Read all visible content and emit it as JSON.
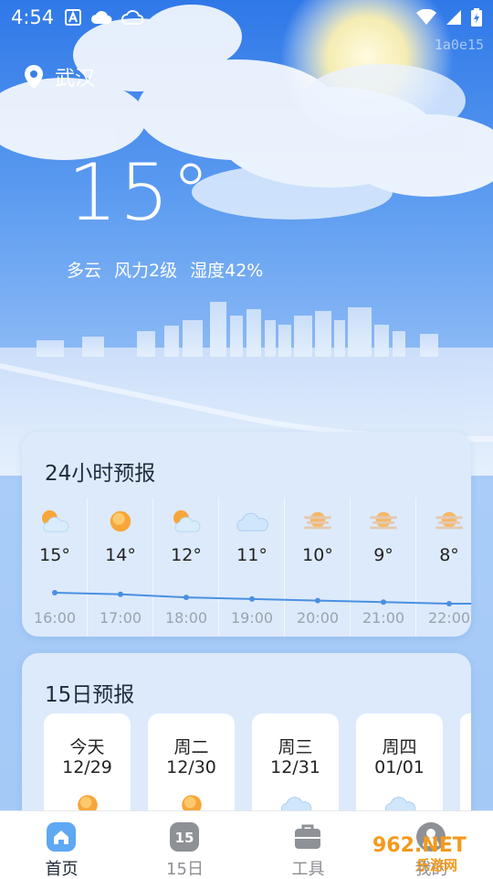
{
  "status": {
    "time": "4:54",
    "left_icons": [
      "a-badge-icon",
      "cloud-filled-icon",
      "cloud-outline-icon"
    ],
    "right_icons": [
      "wifi-icon",
      "signal-icon",
      "battery-icon"
    ]
  },
  "build_tag": "1a0e15",
  "location": {
    "city": "武汉",
    "icon": "location-pin-icon"
  },
  "current": {
    "temperature": "15°",
    "condition": "多云",
    "wind": "风力2级",
    "humidity": "湿度42%"
  },
  "hourly": {
    "title": "24小时预报",
    "items": [
      {
        "time": "16:00",
        "temp": "15°",
        "temp_value": 15,
        "icon": "partly-cloudy-icon"
      },
      {
        "time": "17:00",
        "temp": "14°",
        "temp_value": 14,
        "icon": "sun-icon"
      },
      {
        "time": "18:00",
        "temp": "12°",
        "temp_value": 12,
        "icon": "partly-cloudy-icon"
      },
      {
        "time": "19:00",
        "temp": "11°",
        "temp_value": 11,
        "icon": "cloudy-icon"
      },
      {
        "time": "20:00",
        "temp": "10°",
        "temp_value": 10,
        "icon": "haze-icon"
      },
      {
        "time": "21:00",
        "temp": "9°",
        "temp_value": 9,
        "icon": "haze-icon"
      },
      {
        "time": "22:00",
        "temp": "8°",
        "temp_value": 8,
        "icon": "haze-icon"
      }
    ]
  },
  "daily": {
    "title": "15日预报",
    "items": [
      {
        "day": "今天",
        "date": "12/29",
        "icon": "sun-icon"
      },
      {
        "day": "周二",
        "date": "12/30",
        "icon": "sun-icon"
      },
      {
        "day": "周三",
        "date": "12/31",
        "icon": "cloudy-icon"
      },
      {
        "day": "周四",
        "date": "01/01",
        "icon": "cloudy-icon"
      }
    ]
  },
  "tabs": [
    {
      "label": "首页",
      "icon": "home-icon",
      "active": true
    },
    {
      "label": "15日",
      "icon": "calendar-15-icon",
      "badge": "15",
      "active": false
    },
    {
      "label": "工具",
      "icon": "toolbox-icon",
      "active": false
    },
    {
      "label": "我的",
      "icon": "profile-icon",
      "active": false
    }
  ],
  "watermark": {
    "text": "962.NET",
    "subtext": "乐游网"
  },
  "colors": {
    "sky_top": "#2f78e8",
    "card_bg": "#ddeafb",
    "trend_line": "#4a90e2",
    "tab_active": "#1f2a3a",
    "tab_inactive": "#8c8f94"
  }
}
